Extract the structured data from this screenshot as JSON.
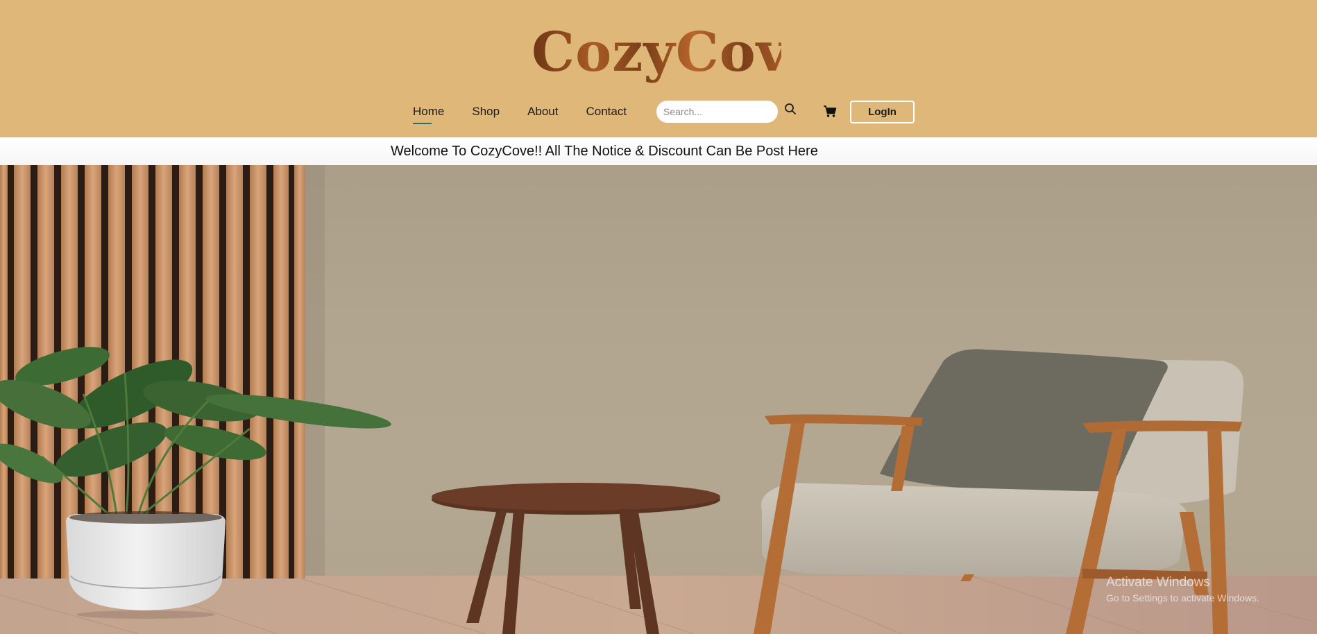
{
  "brand": {
    "name": "CozyCove"
  },
  "nav": {
    "items": [
      {
        "label": "Home",
        "active": true
      },
      {
        "label": "Shop",
        "active": false
      },
      {
        "label": "About",
        "active": false
      },
      {
        "label": "Contact",
        "active": false
      }
    ]
  },
  "search": {
    "placeholder": "Search...",
    "value": ""
  },
  "icons": {
    "search": "search-icon",
    "cart": "cart-icon"
  },
  "login": {
    "label": "LogIn"
  },
  "notice": {
    "text": "Welcome To CozyCove!! All The Notice & Discount Can Be Post Here"
  },
  "watermark": {
    "title": "Activate Windows",
    "subtitle": "Go to Settings to activate Windows."
  },
  "colors": {
    "header_bg": "#deb779",
    "accent": "#2a6d6d"
  }
}
